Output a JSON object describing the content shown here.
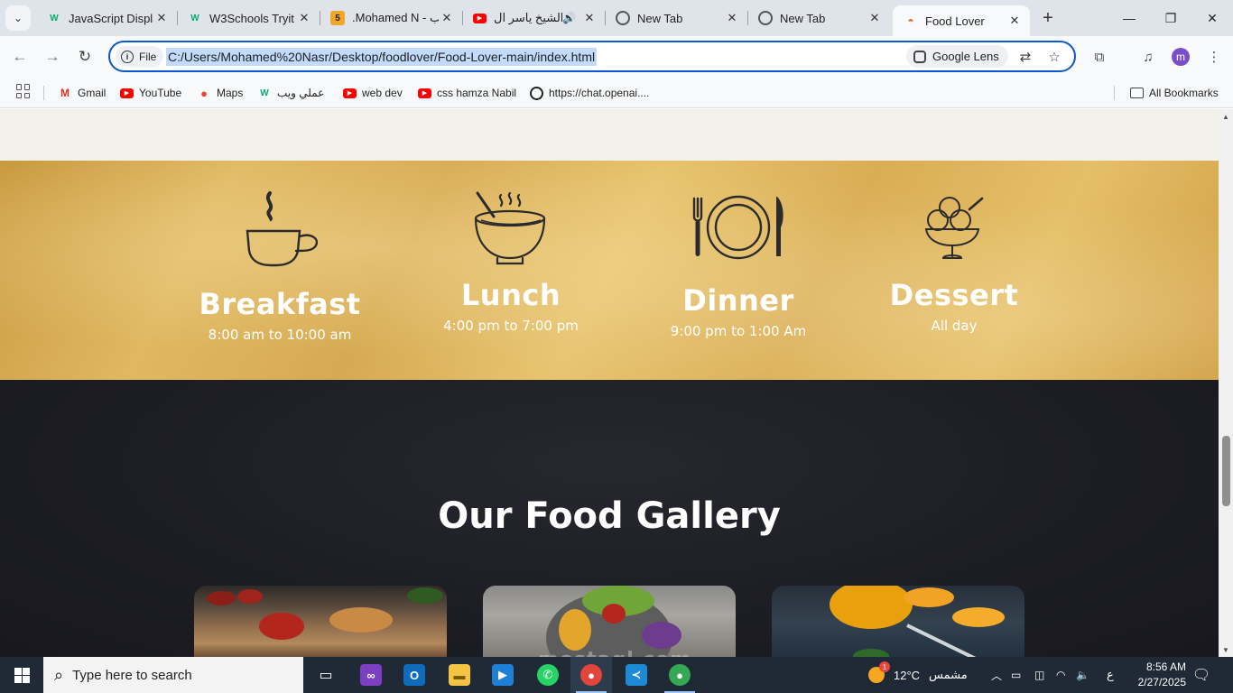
{
  "browser": {
    "tabs": [
      {
        "title": "JavaScript Displa",
        "favicon": "w3schools-icon"
      },
      {
        "title": "W3Schools Tryit",
        "favicon": "w3schools-icon"
      },
      {
        "title": ".Mohamed N - ب",
        "favicon": "html5-icon"
      },
      {
        "title": "الشيخ ياسر ال",
        "favicon": "youtube-icon"
      },
      {
        "title": "New Tab",
        "favicon": "chrome-icon"
      },
      {
        "title": "New Tab",
        "favicon": "chrome-icon"
      },
      {
        "title": "Food Lover",
        "favicon": "food-lover-icon",
        "active": true
      }
    ],
    "address": {
      "scheme_label": "File",
      "url": "C:/Users/Mohamed%20Nasr/Desktop/foodlover/Food-Lover-main/index.html",
      "lens_label": "Google Lens"
    },
    "profile_initial": "m",
    "bookmarks": [
      {
        "label": "Gmail"
      },
      {
        "label": "YouTube"
      },
      {
        "label": "Maps"
      },
      {
        "label": "عملي ويب"
      },
      {
        "label": "web dev"
      },
      {
        "label": "css hamza Nabil"
      },
      {
        "label": "https://chat.openai...."
      }
    ],
    "all_bookmarks_label": "All Bookmarks"
  },
  "page": {
    "meals": [
      {
        "name": "Breakfast",
        "time": "8:00 am to 10:00 am",
        "icon": "coffee-cup-icon"
      },
      {
        "name": "Lunch",
        "time": "4:00 pm to 7:00 pm",
        "icon": "soup-bowl-icon"
      },
      {
        "name": "Dinner",
        "time": "9:00 pm to 1:00 Am",
        "icon": "plate-cutlery-icon"
      },
      {
        "name": "Dessert",
        "time": "All day",
        "icon": "ice-cream-cup-icon"
      }
    ],
    "gallery_title": "Our Food Gallery",
    "watermark": "mostaql.com"
  },
  "taskbar": {
    "search_placeholder": "Type here to search",
    "weather_temp": "12°C",
    "weather_text": "مشمس",
    "weather_badge": "1",
    "language": "ع",
    "time": "8:56 AM",
    "date": "2/27/2025"
  },
  "colors": {
    "accent_blue": "#0b57d0",
    "hours_band": "#dcb05a",
    "gallery_bg": "#1c1c23",
    "taskbar_bg": "#1f2a36"
  }
}
